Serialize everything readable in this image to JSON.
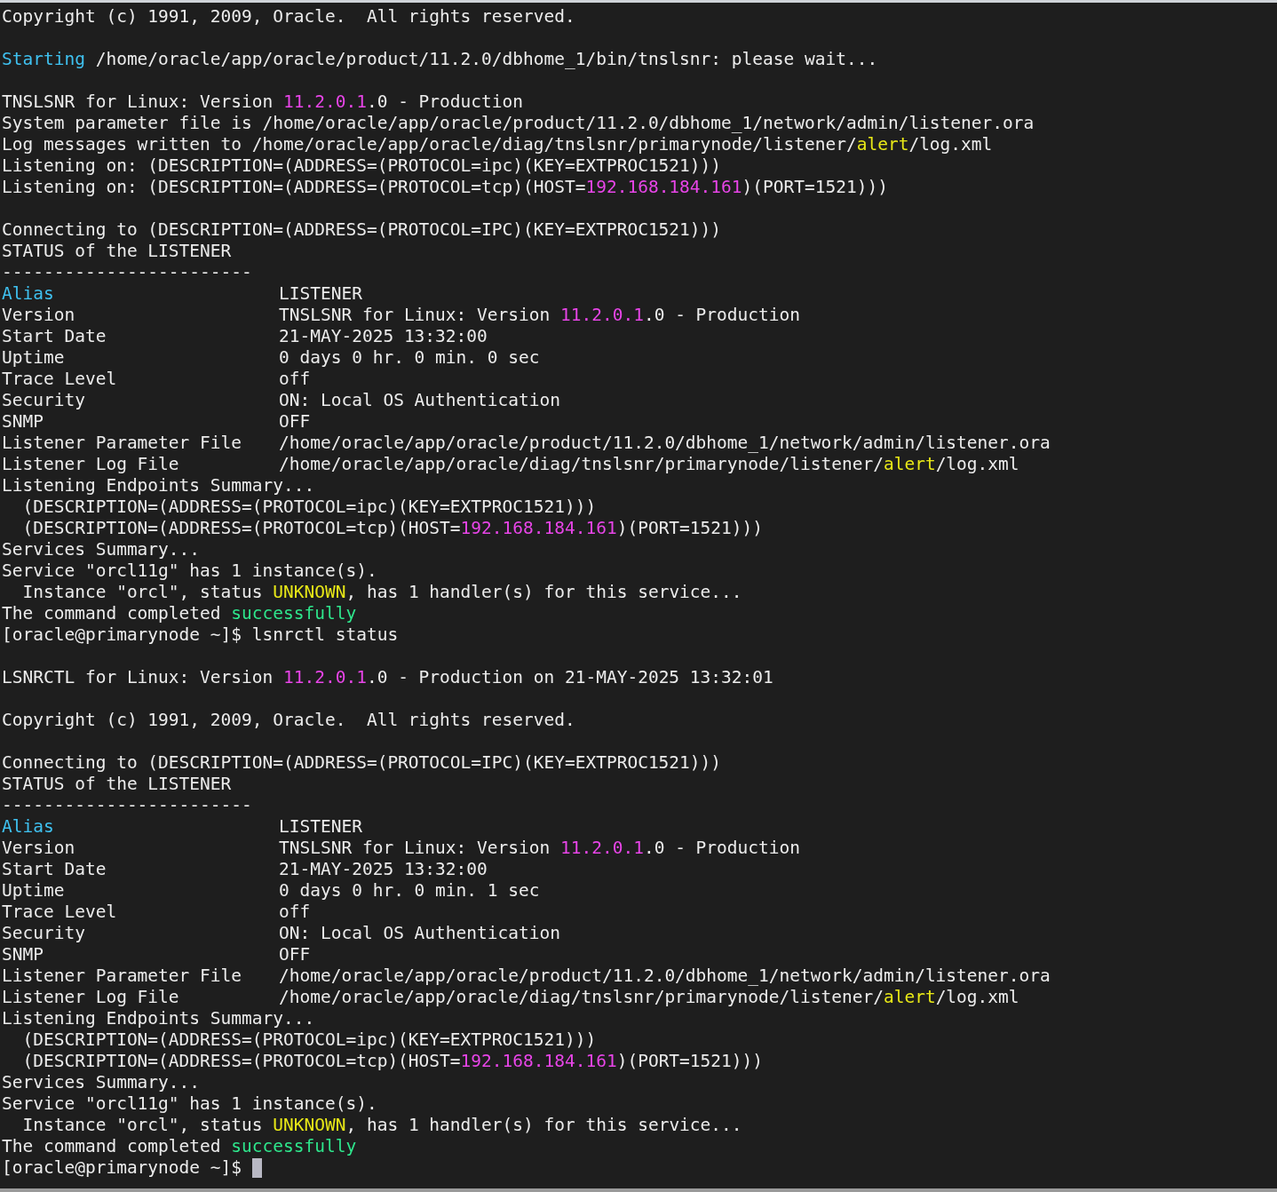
{
  "terminal": {
    "lines": [
      {
        "kind": "text",
        "segments": [
          {
            "text": "Copyright (c) 1991, 2009, Oracle.  All rights reserved."
          }
        ]
      },
      {
        "kind": "blank"
      },
      {
        "kind": "text",
        "segments": [
          {
            "text": "Starting",
            "color": "#3fc1f0"
          },
          {
            "text": " /home/oracle/app/oracle/product/11.2.0/dbhome_1/bin/tnslsnr: please wait..."
          }
        ]
      },
      {
        "kind": "blank"
      },
      {
        "kind": "text",
        "segments": [
          {
            "text": "TNSLSNR for Linux: Version "
          },
          {
            "text": "11.2.0.1",
            "color": "#e845e8"
          },
          {
            "text": ".0 - Production"
          }
        ]
      },
      {
        "kind": "text",
        "segments": [
          {
            "text": "System parameter file is /home/oracle/app/oracle/product/11.2.0/dbhome_1/network/admin/listener.ora"
          }
        ]
      },
      {
        "kind": "text",
        "segments": [
          {
            "text": "Log messages written to /home/oracle/app/oracle/diag/tnslsnr/primarynode/listener/"
          },
          {
            "text": "alert",
            "color": "#e8e817"
          },
          {
            "text": "/log.xml"
          }
        ]
      },
      {
        "kind": "text",
        "segments": [
          {
            "text": "Listening on: (DESCRIPTION=(ADDRESS=(PROTOCOL=ipc)(KEY=EXTPROC1521)))"
          }
        ]
      },
      {
        "kind": "text",
        "segments": [
          {
            "text": "Listening on: (DESCRIPTION=(ADDRESS=(PROTOCOL=tcp)(HOST="
          },
          {
            "text": "192.168.184.161",
            "color": "#e845e8"
          },
          {
            "text": ")(PORT=1521)))"
          }
        ]
      },
      {
        "kind": "blank"
      },
      {
        "kind": "text",
        "segments": [
          {
            "text": "Connecting to (DESCRIPTION=(ADDRESS=(PROTOCOL=IPC)(KEY=EXTPROC1521)))"
          }
        ]
      },
      {
        "kind": "text",
        "segments": [
          {
            "text": "STATUS of the LISTENER"
          }
        ]
      },
      {
        "kind": "text",
        "segments": [
          {
            "text": "------------------------"
          }
        ]
      },
      {
        "kind": "field",
        "label": [
          {
            "text": "Alias",
            "color": "#3fc1f0"
          }
        ],
        "value": [
          {
            "text": "LISTENER"
          }
        ]
      },
      {
        "kind": "field",
        "label": [
          {
            "text": "Version"
          }
        ],
        "value": [
          {
            "text": "TNSLSNR for Linux: Version "
          },
          {
            "text": "11.2.0.1",
            "color": "#e845e8"
          },
          {
            "text": ".0 - Production"
          }
        ]
      },
      {
        "kind": "field",
        "label": [
          {
            "text": "Start Date"
          }
        ],
        "value": [
          {
            "text": "21-MAY-2025 13:32:00"
          }
        ]
      },
      {
        "kind": "field",
        "label": [
          {
            "text": "Uptime"
          }
        ],
        "value": [
          {
            "text": "0 days 0 hr. 0 min. 0 sec"
          }
        ]
      },
      {
        "kind": "field",
        "label": [
          {
            "text": "Trace Level"
          }
        ],
        "value": [
          {
            "text": "off"
          }
        ]
      },
      {
        "kind": "field",
        "label": [
          {
            "text": "Security"
          }
        ],
        "value": [
          {
            "text": "ON: Local OS Authentication"
          }
        ]
      },
      {
        "kind": "field",
        "label": [
          {
            "text": "SNMP"
          }
        ],
        "value": [
          {
            "text": "OFF"
          }
        ]
      },
      {
        "kind": "field",
        "label": [
          {
            "text": "Listener Parameter File"
          }
        ],
        "value": [
          {
            "text": "/home/oracle/app/oracle/product/11.2.0/dbhome_1/network/admin/listener.ora"
          }
        ]
      },
      {
        "kind": "field",
        "label": [
          {
            "text": "Listener Log File"
          }
        ],
        "value": [
          {
            "text": "/home/oracle/app/oracle/diag/tnslsnr/primarynode/listener/"
          },
          {
            "text": "alert",
            "color": "#e8e817"
          },
          {
            "text": "/log.xml"
          }
        ]
      },
      {
        "kind": "text",
        "segments": [
          {
            "text": "Listening Endpoints Summary..."
          }
        ]
      },
      {
        "kind": "text",
        "segments": [
          {
            "text": "  (DESCRIPTION=(ADDRESS=(PROTOCOL=ipc)(KEY=EXTPROC1521)))"
          }
        ]
      },
      {
        "kind": "text",
        "segments": [
          {
            "text": "  (DESCRIPTION=(ADDRESS=(PROTOCOL=tcp)(HOST="
          },
          {
            "text": "192.168.184.161",
            "color": "#e845e8"
          },
          {
            "text": ")(PORT=1521)))"
          }
        ]
      },
      {
        "kind": "text",
        "segments": [
          {
            "text": "Services Summary..."
          }
        ]
      },
      {
        "kind": "text",
        "segments": [
          {
            "text": "Service \"orcl11g\" has 1 instance(s)."
          }
        ]
      },
      {
        "kind": "text",
        "segments": [
          {
            "text": "  Instance \"orcl\", status "
          },
          {
            "text": "UNKNOWN",
            "color": "#e8e817"
          },
          {
            "text": ", has 1 handler(s) for this service..."
          }
        ]
      },
      {
        "kind": "text",
        "segments": [
          {
            "text": "The command completed "
          },
          {
            "text": "successfully",
            "color": "#2ee68c"
          }
        ]
      },
      {
        "kind": "text",
        "segments": [
          {
            "text": "[oracle@primarynode ~]$ lsnrctl status"
          }
        ]
      },
      {
        "kind": "blank"
      },
      {
        "kind": "text",
        "segments": [
          {
            "text": "LSNRCTL for Linux: Version "
          },
          {
            "text": "11.2.0.1",
            "color": "#e845e8"
          },
          {
            "text": ".0 - Production on 21-MAY-2025 13:32:01"
          }
        ]
      },
      {
        "kind": "blank"
      },
      {
        "kind": "text",
        "segments": [
          {
            "text": "Copyright (c) 1991, 2009, Oracle.  All rights reserved."
          }
        ]
      },
      {
        "kind": "blank"
      },
      {
        "kind": "text",
        "segments": [
          {
            "text": "Connecting to (DESCRIPTION=(ADDRESS=(PROTOCOL=IPC)(KEY=EXTPROC1521)))"
          }
        ]
      },
      {
        "kind": "text",
        "segments": [
          {
            "text": "STATUS of the LISTENER"
          }
        ]
      },
      {
        "kind": "text",
        "segments": [
          {
            "text": "------------------------"
          }
        ]
      },
      {
        "kind": "field",
        "label": [
          {
            "text": "Alias",
            "color": "#3fc1f0"
          }
        ],
        "value": [
          {
            "text": "LISTENER"
          }
        ]
      },
      {
        "kind": "field",
        "label": [
          {
            "text": "Version"
          }
        ],
        "value": [
          {
            "text": "TNSLSNR for Linux: Version "
          },
          {
            "text": "11.2.0.1",
            "color": "#e845e8"
          },
          {
            "text": ".0 - Production"
          }
        ]
      },
      {
        "kind": "field",
        "label": [
          {
            "text": "Start Date"
          }
        ],
        "value": [
          {
            "text": "21-MAY-2025 13:32:00"
          }
        ]
      },
      {
        "kind": "field",
        "label": [
          {
            "text": "Uptime"
          }
        ],
        "value": [
          {
            "text": "0 days 0 hr. 0 min. 1 sec"
          }
        ]
      },
      {
        "kind": "field",
        "label": [
          {
            "text": "Trace Level"
          }
        ],
        "value": [
          {
            "text": "off"
          }
        ]
      },
      {
        "kind": "field",
        "label": [
          {
            "text": "Security"
          }
        ],
        "value": [
          {
            "text": "ON: Local OS Authentication"
          }
        ]
      },
      {
        "kind": "field",
        "label": [
          {
            "text": "SNMP"
          }
        ],
        "value": [
          {
            "text": "OFF"
          }
        ]
      },
      {
        "kind": "field",
        "label": [
          {
            "text": "Listener Parameter File"
          }
        ],
        "value": [
          {
            "text": "/home/oracle/app/oracle/product/11.2.0/dbhome_1/network/admin/listener.ora"
          }
        ]
      },
      {
        "kind": "field",
        "label": [
          {
            "text": "Listener Log File"
          }
        ],
        "value": [
          {
            "text": "/home/oracle/app/oracle/diag/tnslsnr/primarynode/listener/"
          },
          {
            "text": "alert",
            "color": "#e8e817"
          },
          {
            "text": "/log.xml"
          }
        ]
      },
      {
        "kind": "text",
        "segments": [
          {
            "text": "Listening Endpoints Summary..."
          }
        ]
      },
      {
        "kind": "text",
        "segments": [
          {
            "text": "  (DESCRIPTION=(ADDRESS=(PROTOCOL=ipc)(KEY=EXTPROC1521)))"
          }
        ]
      },
      {
        "kind": "text",
        "segments": [
          {
            "text": "  (DESCRIPTION=(ADDRESS=(PROTOCOL=tcp)(HOST="
          },
          {
            "text": "192.168.184.161",
            "color": "#e845e8"
          },
          {
            "text": ")(PORT=1521)))"
          }
        ]
      },
      {
        "kind": "text",
        "segments": [
          {
            "text": "Services Summary..."
          }
        ]
      },
      {
        "kind": "text",
        "segments": [
          {
            "text": "Service \"orcl11g\" has 1 instance(s)."
          }
        ]
      },
      {
        "kind": "text",
        "segments": [
          {
            "text": "  Instance \"orcl\", status "
          },
          {
            "text": "UNKNOWN",
            "color": "#e8e817"
          },
          {
            "text": ", has 1 handler(s) for this service..."
          }
        ]
      },
      {
        "kind": "text",
        "segments": [
          {
            "text": "The command completed "
          },
          {
            "text": "successfully",
            "color": "#2ee68c"
          }
        ]
      },
      {
        "kind": "prompt",
        "segments": [
          {
            "text": "[oracle@primarynode ~]$"
          }
        ]
      }
    ]
  }
}
